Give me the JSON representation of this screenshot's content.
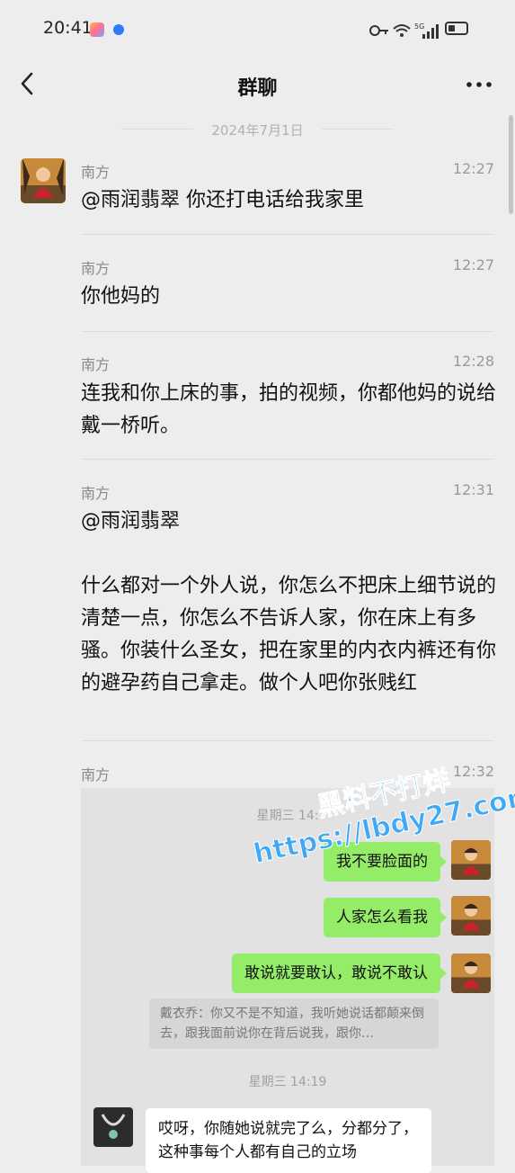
{
  "status_bar": {
    "time": "20:41",
    "network": "5G",
    "icons": "⚷ ◠ 5G ▮▮▮"
  },
  "header": {
    "title": "群聊"
  },
  "date_divider": "2024年7月1日",
  "colors": {
    "background": "#ededed",
    "bubble_self": "#95ec69",
    "forward_card": "#e2e2e2"
  },
  "messages": [
    {
      "sender": "南方",
      "time": "12:27",
      "text": "@雨润翡翠 你还打电话给我家里"
    },
    {
      "sender": "南方",
      "time": "12:27",
      "text": "你他妈的"
    },
    {
      "sender": "南方",
      "time": "12:28",
      "text": "连我和你上床的事，拍的视频，你都他妈的说给戴一桥听。"
    },
    {
      "sender": "南方",
      "time": "12:31",
      "text": "@雨润翡翠\n\n什么都对一个外人说，你怎么不把床上细节说的清楚一点，你怎么不告诉人家，你在床上有多骚。你装什么圣女，把在家里的内衣内裤还有你的避孕药自己拿走。做个人吧你张贱红"
    },
    {
      "sender": "南方",
      "time": "12:32"
    }
  ],
  "forwarded": {
    "day1": "星期三 14:",
    "bubbles": [
      "我不要脸面的",
      "人家怎么看我",
      "敢说就要敢认，敢说不敢认"
    ],
    "quote": "戴衣乔：你又不是不知道，我听她说话都颠来倒去，跟我面前说你在背后说我，跟你…",
    "day2": "星期三 14:19",
    "reply": "哎呀，你随她说就完了么，分都分了，这种事每个人都有自己的立场"
  },
  "watermark": {
    "line1": "黑料不打烊",
    "line2": "https://lbdy27.com"
  }
}
